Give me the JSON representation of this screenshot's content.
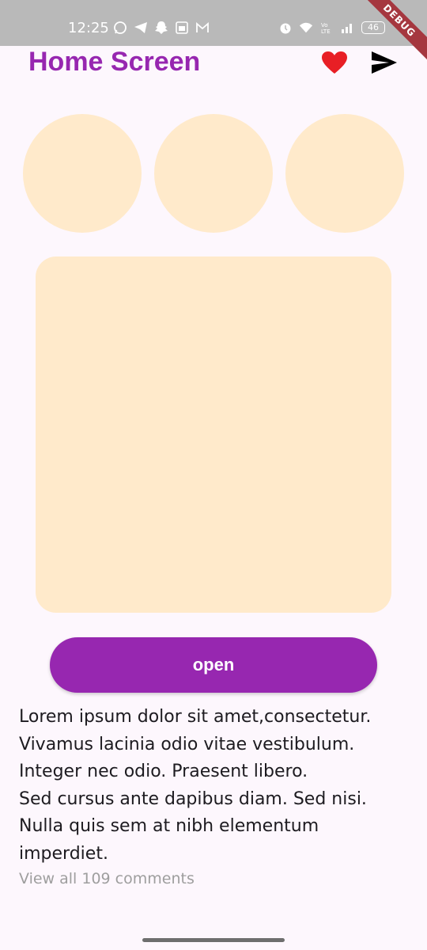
{
  "status_bar": {
    "time": "12:25",
    "battery": "46",
    "left_icons": [
      "whatsapp-icon",
      "telegram-icon",
      "snapchat-icon",
      "calendar-app-icon",
      "gmail-icon"
    ],
    "right_icons": [
      "alarm-icon",
      "wifi-icon",
      "volte-icon",
      "signal-icon"
    ],
    "debug_banner": "DEBUG"
  },
  "app_bar": {
    "title": "Home Screen",
    "actions": [
      "heart-icon",
      "send-icon"
    ]
  },
  "circles": [
    {
      "name": "circle-1"
    },
    {
      "name": "circle-2"
    },
    {
      "name": "circle-3"
    }
  ],
  "button": {
    "label": "open"
  },
  "post": {
    "lines": [
      "Lorem ipsum dolor sit amet,consectetur.",
      "Vivamus lacinia odio vitae vestibulum.",
      "Integer nec odio. Praesent libero.",
      "Sed cursus ante dapibus diam. Sed nisi.",
      "Nulla quis sem at nibh elementum",
      "imperdiet."
    ],
    "comments_link": "View all 109 comments"
  },
  "colors": {
    "primary": "#9727b0",
    "placeholder": "#ffeacb",
    "heart": "#e81f25",
    "background": "#fdf7fd",
    "status_bar": "#b9b9b9",
    "debug": "#a5373f"
  }
}
